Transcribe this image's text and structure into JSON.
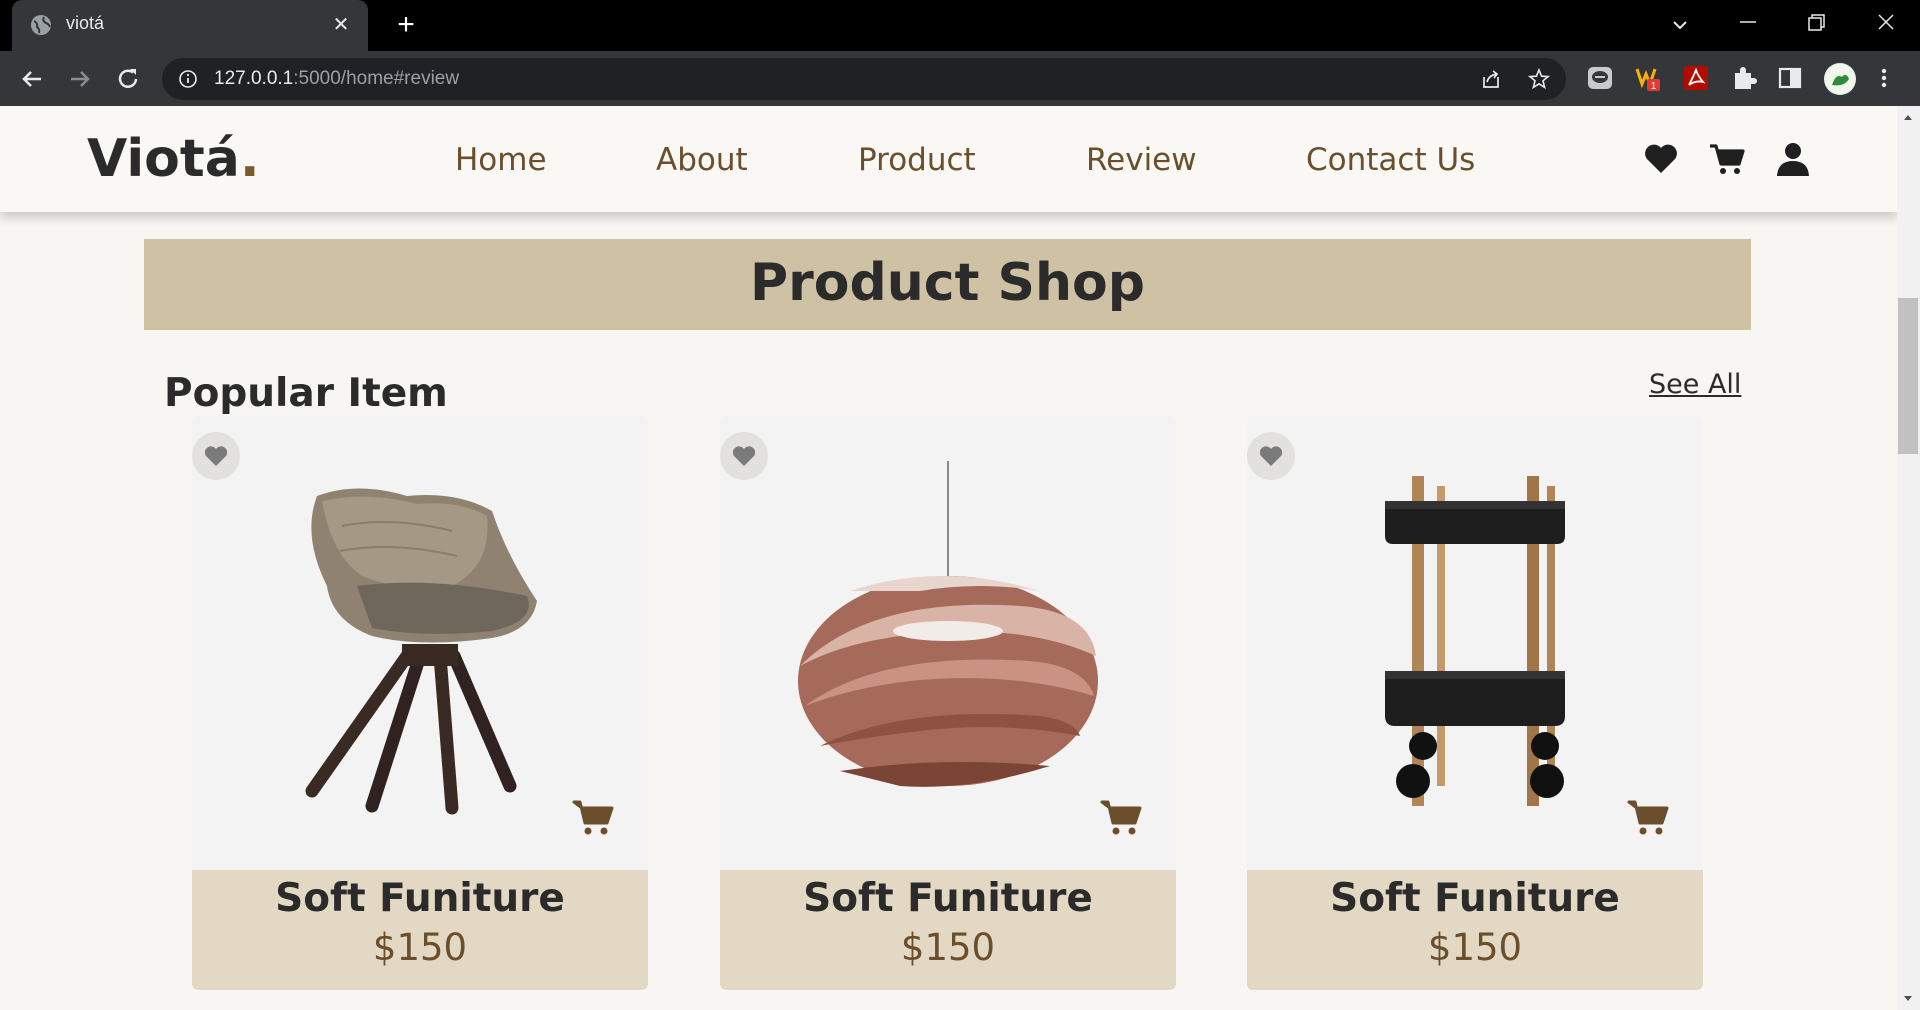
{
  "browser": {
    "tab_title": "viotá",
    "url_host": "127.0.0.1",
    "url_rest": ":5000/home#review",
    "colors": {
      "tabbar": "#000000",
      "toolbar": "#35363a",
      "omnibox": "#202124"
    }
  },
  "site": {
    "logo_text": "Viotá",
    "logo_dot": ".",
    "nav": [
      {
        "label": "Home"
      },
      {
        "label": "About"
      },
      {
        "label": "Product"
      },
      {
        "label": "Review"
      },
      {
        "label": "Contact Us"
      }
    ],
    "header_icons": [
      "heart-icon",
      "cart-icon",
      "user-icon"
    ],
    "colors": {
      "accent": "#6b4f2c",
      "banner": "#cfc1a4",
      "card_info": "#e2d8c3",
      "text": "#2b2b2b"
    }
  },
  "main": {
    "banner_title": "Product Shop",
    "section_title": "Popular Item",
    "see_all": "See All",
    "products": [
      {
        "name": "Soft Funiture",
        "price": "$150",
        "image": "swivel-chair"
      },
      {
        "name": "Soft Funiture",
        "price": "$150",
        "image": "copper-pendant-lamp"
      },
      {
        "name": "Soft Funiture",
        "price": "$150",
        "image": "black-serving-cart"
      }
    ]
  }
}
